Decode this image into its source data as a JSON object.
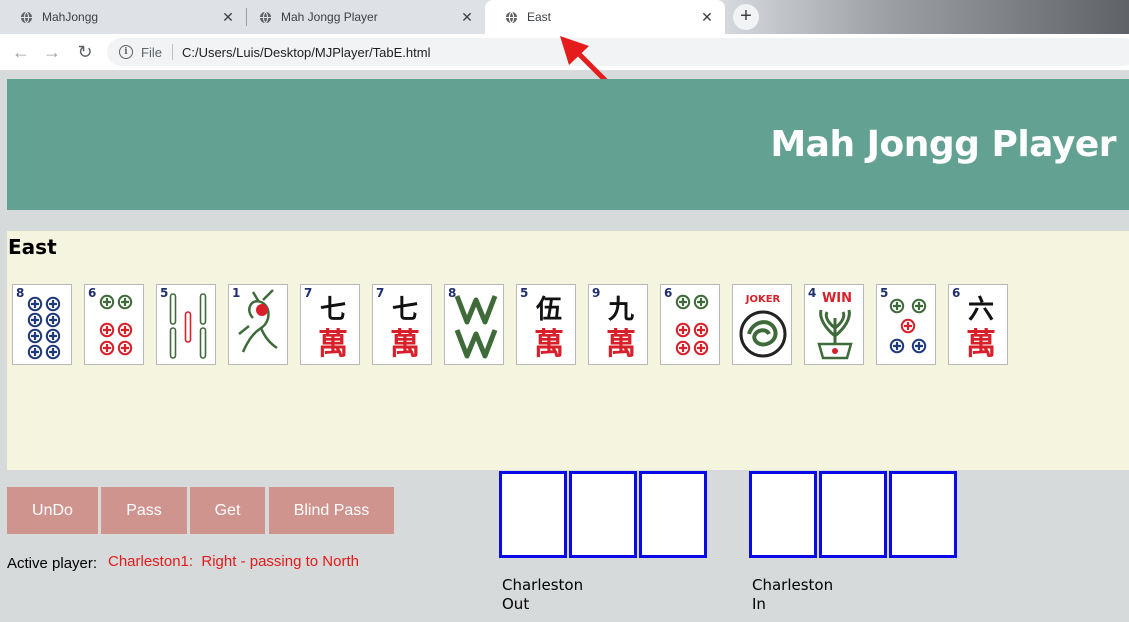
{
  "browser": {
    "tabs": [
      {
        "title": "MahJongg"
      },
      {
        "title": "Mah Jongg Player"
      },
      {
        "title": "East"
      }
    ],
    "new_tab_glyph": "+",
    "close_glyph": "✕",
    "address": {
      "scheme_label": "File",
      "url": "C:/Users/Luis/Desktop/MJPlayer/TabE.html"
    },
    "annotation_color": "#e51c1c"
  },
  "header": {
    "title": "Mah Jongg Player",
    "background": "#63a293"
  },
  "hand": {
    "player": "East",
    "tiles": [
      {
        "number": "8",
        "suit": "dots",
        "icon": "eight-dots-tile-icon"
      },
      {
        "number": "6",
        "suit": "dots",
        "icon": "six-dots-tile-icon"
      },
      {
        "number": "5",
        "suit": "bams",
        "icon": "five-bam-tile-icon"
      },
      {
        "number": "1",
        "suit": "bams",
        "icon": "one-bam-bird-tile-icon"
      },
      {
        "number": "7",
        "suit": "craks",
        "character": "七",
        "icon": "seven-crak-tile-icon"
      },
      {
        "number": "7",
        "suit": "craks",
        "character": "七",
        "icon": "seven-crak-tile-icon"
      },
      {
        "number": "8",
        "suit": "bams",
        "icon": "eight-bam-tile-icon"
      },
      {
        "number": "5",
        "suit": "craks",
        "character": "伍",
        "icon": "five-crak-tile-icon"
      },
      {
        "number": "9",
        "suit": "craks",
        "character": "九",
        "icon": "nine-crak-tile-icon"
      },
      {
        "number": "6",
        "suit": "dots",
        "icon": "six-dots-tile-icon"
      },
      {
        "number": "",
        "suit": "joker",
        "label": "JOKER",
        "icon": "joker-tile-icon"
      },
      {
        "number": "4",
        "suit": "flower",
        "label": "WIN",
        "icon": "flower-win-tile-icon"
      },
      {
        "number": "5",
        "suit": "dots",
        "icon": "five-dots-tile-icon"
      },
      {
        "number": "6",
        "suit": "craks",
        "character": "六",
        "icon": "six-crak-tile-icon"
      }
    ],
    "crak_character": "萬"
  },
  "buttons": {
    "undo": "UnDo",
    "pass": "Pass",
    "get": "Get",
    "blind_pass": "Blind Pass"
  },
  "status": {
    "label": "Active player:",
    "value": "Charleston1:  Right - passing to North"
  },
  "charleston": {
    "out": {
      "line1": "Charleston",
      "line2": "Out",
      "slots": 3
    },
    "in": {
      "line1": "Charleston",
      "line2": "In",
      "slots": 3
    }
  }
}
